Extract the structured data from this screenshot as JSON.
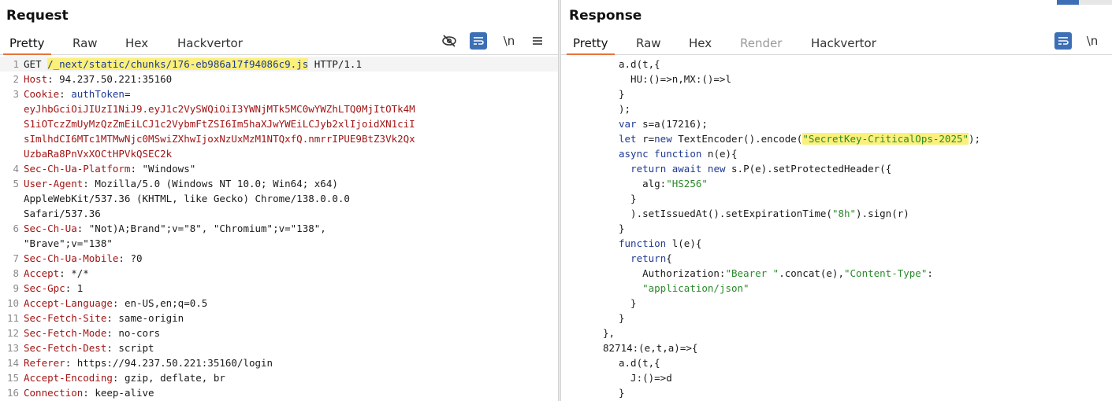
{
  "request": {
    "title": "Request",
    "tabs": [
      "Pretty",
      "Raw",
      "Hex",
      "Hackvertor"
    ],
    "newline_toggle": "\\n",
    "lines": [
      {
        "n": "1",
        "spans": [
          {
            "t": "GET "
          },
          {
            "t": "/_next/static/chunks/176-eb986a17f94086c9.js",
            "c": "kw hl"
          },
          {
            "t": " HTTP/1.1"
          }
        ]
      },
      {
        "n": "2",
        "spans": [
          {
            "t": "Host",
            "c": "hdr"
          },
          {
            "t": ": 94.237.50.221:35160"
          }
        ]
      },
      {
        "n": "3",
        "spans": [
          {
            "t": "Cookie",
            "c": "hdr"
          },
          {
            "t": ": "
          },
          {
            "t": "authToken",
            "c": "kw"
          },
          {
            "t": "="
          }
        ]
      },
      {
        "n": "",
        "spans": [
          {
            "t": "eyJhbGciOiJIUzI1NiJ9.eyJ1c2VySWQiOiI3YWNjMTk5MC0wYWZhLTQ0MjItOTk4M",
            "c": "hdr"
          }
        ]
      },
      {
        "n": "",
        "spans": [
          {
            "t": "S1iOTczZmUyMzQzZmEiLCJ1c2VybmFtZSI6Im5haXJwYWEiLCJyb2xlIjoidXN1ciI",
            "c": "hdr"
          }
        ]
      },
      {
        "n": "",
        "spans": [
          {
            "t": "sImlhdCI6MTc1MTMwNjc0MSwiZXhwIjoxNzUxMzM1NTQxfQ.nmrrIPUE9BtZ3Vk2Qx",
            "c": "hdr"
          }
        ]
      },
      {
        "n": "",
        "spans": [
          {
            "t": "UzbaRa8PnVxXOCtHPVkQSEC2k",
            "c": "hdr"
          }
        ]
      },
      {
        "n": "4",
        "spans": [
          {
            "t": "Sec-Ch-Ua-Platform",
            "c": "hdr"
          },
          {
            "t": ": \"Windows\""
          }
        ]
      },
      {
        "n": "5",
        "spans": [
          {
            "t": "User-Agent",
            "c": "hdr"
          },
          {
            "t": ": Mozilla/5.0 (Windows NT 10.0; Win64; x64)"
          }
        ]
      },
      {
        "n": "",
        "spans": [
          {
            "t": "AppleWebKit/537.36 (KHTML, like Gecko) Chrome/138.0.0.0"
          }
        ]
      },
      {
        "n": "",
        "spans": [
          {
            "t": "Safari/537.36"
          }
        ]
      },
      {
        "n": "6",
        "spans": [
          {
            "t": "Sec-Ch-Ua",
            "c": "hdr"
          },
          {
            "t": ": \"Not)A;Brand\";v=\"8\", \"Chromium\";v=\"138\","
          }
        ]
      },
      {
        "n": "",
        "spans": [
          {
            "t": "\"Brave\";v=\"138\""
          }
        ]
      },
      {
        "n": "7",
        "spans": [
          {
            "t": "Sec-Ch-Ua-Mobile",
            "c": "hdr"
          },
          {
            "t": ": ?0"
          }
        ]
      },
      {
        "n": "8",
        "spans": [
          {
            "t": "Accept",
            "c": "hdr"
          },
          {
            "t": ": */*"
          }
        ]
      },
      {
        "n": "9",
        "spans": [
          {
            "t": "Sec-Gpc",
            "c": "hdr"
          },
          {
            "t": ": 1"
          }
        ]
      },
      {
        "n": "10",
        "spans": [
          {
            "t": "Accept-Language",
            "c": "hdr"
          },
          {
            "t": ": en-US,en;q=0.5"
          }
        ]
      },
      {
        "n": "11",
        "spans": [
          {
            "t": "Sec-Fetch-Site",
            "c": "hdr"
          },
          {
            "t": ": same-origin"
          }
        ]
      },
      {
        "n": "12",
        "spans": [
          {
            "t": "Sec-Fetch-Mode",
            "c": "hdr"
          },
          {
            "t": ": no-cors"
          }
        ]
      },
      {
        "n": "13",
        "spans": [
          {
            "t": "Sec-Fetch-Dest",
            "c": "hdr"
          },
          {
            "t": ": script"
          }
        ]
      },
      {
        "n": "14",
        "spans": [
          {
            "t": "Referer",
            "c": "hdr"
          },
          {
            "t": ": https://94.237.50.221:35160/login"
          }
        ]
      },
      {
        "n": "15",
        "spans": [
          {
            "t": "Accept-Encoding",
            "c": "hdr"
          },
          {
            "t": ": gzip, deflate, br"
          }
        ]
      },
      {
        "n": "16",
        "spans": [
          {
            "t": "Connection",
            "c": "hdr"
          },
          {
            "t": ": keep-alive"
          }
        ]
      }
    ]
  },
  "response": {
    "title": "Response",
    "tabs": [
      "Pretty",
      "Raw",
      "Hex",
      "Render",
      "Hackvertor"
    ],
    "newline_toggle": "\\n",
    "lines": [
      {
        "spans": [
          {
            "t": "a.d(t,{"
          }
        ]
      },
      {
        "spans": [
          {
            "t": "  HU:()=>n,MX:()=>l"
          }
        ]
      },
      {
        "spans": [
          {
            "t": "}"
          }
        ]
      },
      {
        "spans": [
          {
            "t": ");"
          }
        ]
      },
      {
        "spans": [
          {
            "t": "var",
            "c": "kw"
          },
          {
            "t": " s=a(17216);"
          }
        ]
      },
      {
        "spans": [
          {
            "t": "let",
            "c": "kw"
          },
          {
            "t": " r="
          },
          {
            "t": "new",
            "c": "kw"
          },
          {
            "t": " TextEncoder().encode("
          },
          {
            "t": "\"SecretKey-CriticalOps-2025\"",
            "c": "str hl"
          },
          {
            "t": ");"
          }
        ]
      },
      {
        "spans": [
          {
            "t": "async",
            "c": "kw"
          },
          {
            "t": " "
          },
          {
            "t": "function",
            "c": "kw"
          },
          {
            "t": " n(e){"
          }
        ]
      },
      {
        "spans": [
          {
            "t": "  "
          },
          {
            "t": "return",
            "c": "kw"
          },
          {
            "t": " "
          },
          {
            "t": "await",
            "c": "kw"
          },
          {
            "t": " "
          },
          {
            "t": "new",
            "c": "kw"
          },
          {
            "t": " s.P(e).setProtectedHeader({"
          }
        ]
      },
      {
        "spans": [
          {
            "t": "    alg:"
          },
          {
            "t": "\"HS256\"",
            "c": "str"
          }
        ]
      },
      {
        "spans": [
          {
            "t": "  }"
          }
        ]
      },
      {
        "spans": [
          {
            "t": "  ).setIssuedAt().setExpirationTime("
          },
          {
            "t": "\"8h\"",
            "c": "str"
          },
          {
            "t": ").sign(r)"
          }
        ]
      },
      {
        "spans": [
          {
            "t": "}"
          }
        ]
      },
      {
        "spans": [
          {
            "t": "function",
            "c": "kw"
          },
          {
            "t": " l(e){"
          }
        ]
      },
      {
        "spans": [
          {
            "t": "  "
          },
          {
            "t": "return",
            "c": "kw"
          },
          {
            "t": "{"
          }
        ]
      },
      {
        "spans": [
          {
            "t": "    Authorization:"
          },
          {
            "t": "\"Bearer \"",
            "c": "str"
          },
          {
            "t": ".concat(e),"
          },
          {
            "t": "\"Content-Type\"",
            "c": "str"
          },
          {
            "t": ":"
          }
        ]
      },
      {
        "spans": [
          {
            "t": "    "
          },
          {
            "t": "\"application/json\"",
            "c": "str"
          }
        ]
      },
      {
        "spans": [
          {
            "t": "  }"
          }
        ]
      },
      {
        "spans": [
          {
            "t": "}"
          }
        ]
      },
      {
        "spans": [
          {
            "t": "},"
          }
        ],
        "indent": -1
      },
      {
        "spans": [
          {
            "t": "82714:(e,t,a)=>{"
          }
        ],
        "indent": -1
      },
      {
        "spans": [
          {
            "t": "a.d(t,{"
          }
        ]
      },
      {
        "spans": [
          {
            "t": "  J:()=>d"
          }
        ]
      },
      {
        "spans": [
          {
            "t": "}"
          }
        ]
      }
    ]
  }
}
